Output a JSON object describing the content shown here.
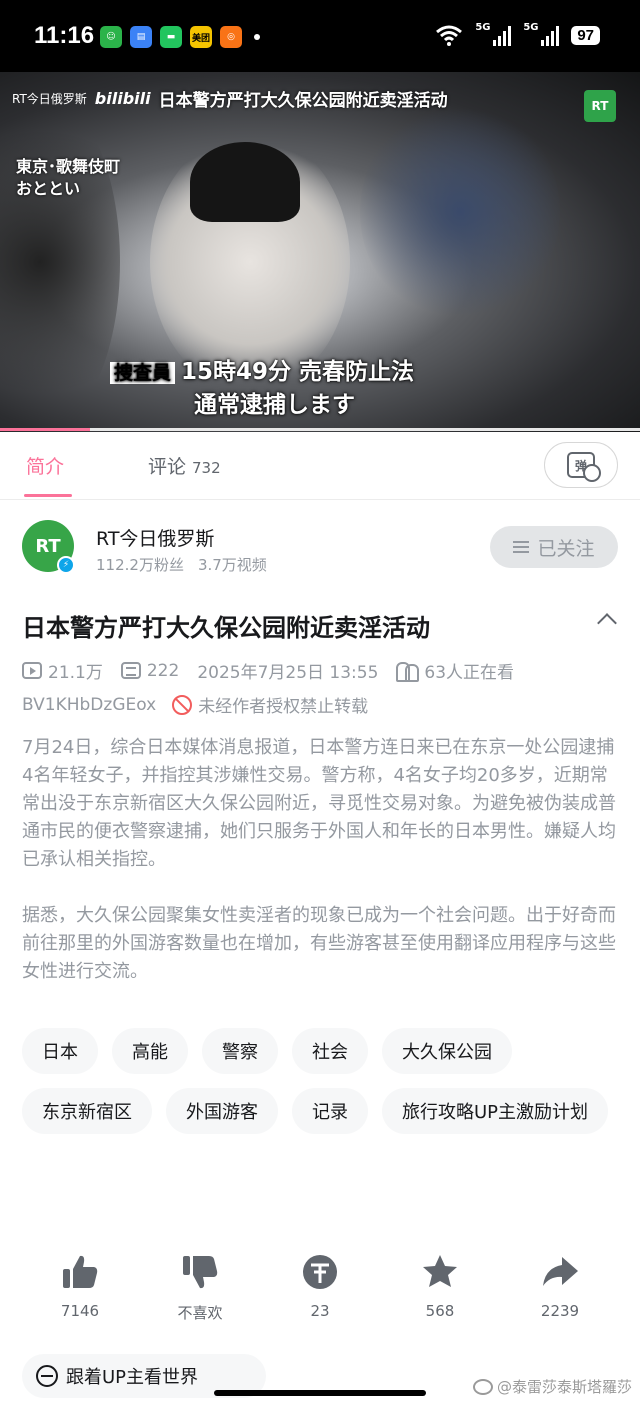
{
  "status_bar": {
    "time": "11:16",
    "signal_1": "5G",
    "signal_2": "5G",
    "battery": "97",
    "apps": [
      "green-app",
      "wallet-app",
      "messages-app",
      "meituan-app",
      "video-app"
    ],
    "meituan_label": "美团"
  },
  "video": {
    "source_label": "RT今日俄罗斯",
    "bili_logo": "bilibili",
    "headline": "日本警方严打大久保公园附近卖淫活动",
    "channel_logo": "RT",
    "location_caption": "東京･歌舞伎町\nおととい",
    "subtitle_tag": "捜査員",
    "subtitle_line1": "15時49分 売春防止法",
    "subtitle_line2": "通常逮捕します",
    "progress": 0.14
  },
  "tabs": [
    {
      "label": "简介",
      "active": true
    },
    {
      "label": "评论",
      "count": "732"
    }
  ],
  "danmu_button": {
    "icon": "danmu-off-icon",
    "glyph": "弹"
  },
  "uploader": {
    "avatar_text": "RT",
    "name": "RT今日俄罗斯",
    "fans": "112.2万粉丝",
    "videos": "3.7万视频",
    "follow_label": "已关注"
  },
  "video_info": {
    "title": "日本警方严打大久保公园附近卖淫活动",
    "views": "21.1万",
    "danmaku": "222",
    "date": "2025年7月25日 13:55",
    "watching": "63人正在看",
    "bvid": "BV1KHbDzGEox",
    "copyright": "未经作者授权禁止转载"
  },
  "description": [
    "7月24日，综合日本媒体消息报道，日本警方连日来已在东京一处公园逮捕4名年轻女子，并指控其涉嫌性交易。警方称，4名女子均20多岁，近期常常出没于东京新宿区大久保公园附近，寻觅性交易对象。为避免被伪装成普通市民的便衣警察逮捕，她们只服务于外国人和年长的日本男性。嫌疑人均已承认相关指控。",
    "据悉，大久保公园聚集女性卖淫者的现象已成为一个社会问题。出于好奇而前往那里的外国游客数量也在增加，有些游客甚至使用翻译应用程序与这些女性进行交流。"
  ],
  "tags": [
    "日本",
    "高能",
    "警察",
    "社会",
    "大久保公园",
    "东京新宿区",
    "外国游客",
    "记录",
    "旅行攻略UP主激励计划"
  ],
  "actions": [
    {
      "name": "like",
      "count": "7146"
    },
    {
      "name": "dislike",
      "count": "不喜欢"
    },
    {
      "name": "coin",
      "count": "23"
    },
    {
      "name": "favorite",
      "count": "568"
    },
    {
      "name": "share",
      "count": "2239"
    }
  ],
  "bottom_chip": "跟着UP主看世界",
  "watermark": "@泰雷莎泰斯塔羅莎",
  "colors": {
    "accent": "#fb7299",
    "muted": "#9499a0",
    "rt_green": "#37a548",
    "ban_red": "#f25d5d"
  }
}
